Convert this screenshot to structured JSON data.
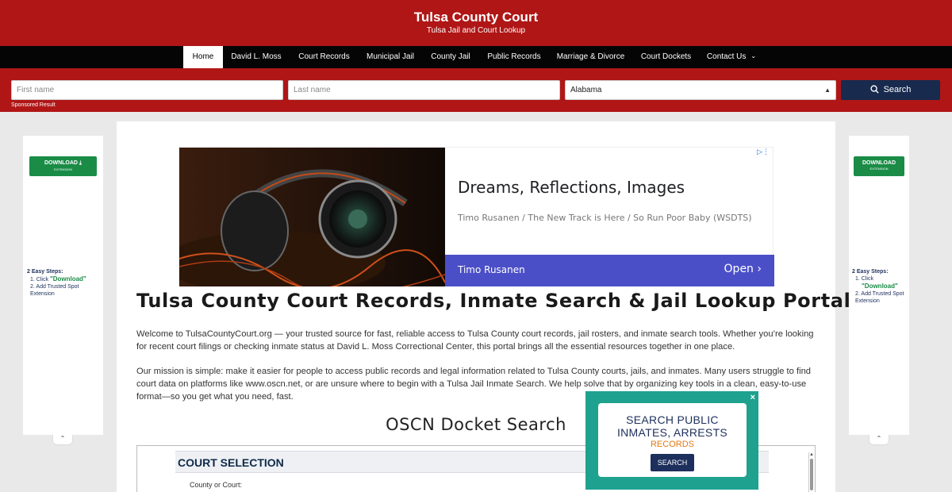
{
  "header": {
    "title": "Tulsa County Court",
    "subtitle": "Tulsa Jail and Court Lookup"
  },
  "nav": {
    "items": [
      {
        "label": "Home",
        "active": true
      },
      {
        "label": "David L. Moss"
      },
      {
        "label": "Court Records"
      },
      {
        "label": "Municipal Jail"
      },
      {
        "label": "County Jail"
      },
      {
        "label": "Public Records"
      },
      {
        "label": "Marriage & Divorce"
      },
      {
        "label": "Court Dockets"
      },
      {
        "label": "Contact Us"
      }
    ]
  },
  "search": {
    "first_placeholder": "First name",
    "last_placeholder": "Last name",
    "state_value": "Alabama",
    "button_label": "Search",
    "sponsored": "Sponsored Result"
  },
  "sidebar_ad": {
    "download_label": "DOWNLOAD",
    "download_sub": "EXTENSION",
    "steps_heading": "2 Easy Steps:",
    "step1_prefix": "Click",
    "step1_link": "\"Download\"",
    "step2": "Add Trusted Spot Extension"
  },
  "ad": {
    "headline": "Dreams, Reflections, Images",
    "text": "Timo Rusanen / The New Track is Here / So Run Poor Baby (WSDTS)",
    "advertiser": "Timo Rusanen",
    "cta": "Open"
  },
  "main": {
    "title": "Tulsa County Court Records, Inmate Search & Jail Lookup Portal",
    "para1": "Welcome to TulsaCountyCourt.org — your trusted source for fast, reliable access to Tulsa County court records, jail rosters, and inmate search tools. Whether you’re looking for recent court filings or checking inmate status at David L. Moss Correctional Center, this portal brings all the essential resources together in one place.",
    "para2": "Our mission is simple: make it easier for people to access public records and legal information related to Tulsa County courts, jails, and inmates. Many users struggle to find court data on platforms like www.oscn.net, or are unsure where to begin with a Tulsa Jail Inmate Search. We help solve that by organizing key tools in a clean, easy-to-use format—so you get what you need, fast.",
    "section_heading": "OSCN Docket Search",
    "embed_heading": "COURT SELECTION",
    "embed_label": "County or Court:"
  },
  "popup": {
    "line1": "SEARCH PUBLIC INMATES, ARRESTS",
    "line2": "RECORDS",
    "button": "SEARCH",
    "close": "×"
  },
  "colors": {
    "brand_red": "#b01616",
    "nav_black": "#050505",
    "search_navy": "#182a4e",
    "popup_teal": "#1fa18f",
    "download_green": "#1a8c46"
  }
}
